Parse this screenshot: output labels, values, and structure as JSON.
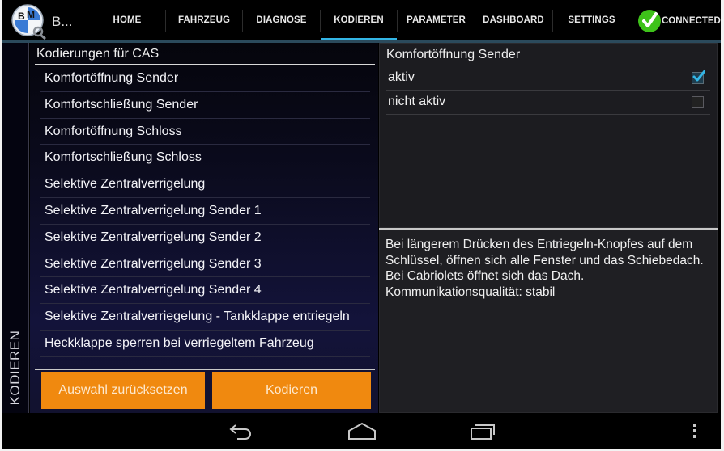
{
  "app": {
    "title": "B...",
    "logo_icon": "bm-logo-magnifier-icon"
  },
  "tabs": [
    {
      "label": "HOME",
      "active": false
    },
    {
      "label": "FAHRZEUG",
      "active": false
    },
    {
      "label": "DIAGNOSE",
      "active": false
    },
    {
      "label": "KODIEREN",
      "active": true
    },
    {
      "label": "PARAMETER",
      "active": false
    },
    {
      "label": "DASHBOARD",
      "active": false
    },
    {
      "label": "SETTINGS",
      "active": false
    }
  ],
  "connection": {
    "label": "CONNECTED",
    "icon": "green-check-icon",
    "color": "#3ec21a"
  },
  "sidebar": {
    "label": "KODIEREN"
  },
  "left_panel": {
    "header": "Kodierungen für CAS",
    "items": [
      "Komfortöffnung Sender",
      "Komfortschließung Sender",
      "Komfortöffnung Schloss",
      "Komfortschließung Schloss",
      "Selektive Zentralverrigelung",
      "Selektive Zentralverrigelung Sender 1",
      "Selektive Zentralverrigelung Sender 2",
      "Selektive Zentralverrigelung Sender 3",
      "Selektive Zentralverrigelung Sender 4",
      "Selektive Zentralverriegelung - Tankklappe entriegeln",
      "Heckklappe sperren bei verriegeltem Fahrzeug"
    ],
    "buttons": {
      "reset": "Auswahl zurücksetzen",
      "code": "Kodieren"
    }
  },
  "right_panel": {
    "header": "Komfortöffnung Sender",
    "options": [
      {
        "label": "aktiv",
        "checked": true
      },
      {
        "label": "nicht aktiv",
        "checked": false
      }
    ],
    "description": "Bei längerem Drücken des Entriegeln-Knopfes auf dem Schlüssel, öffnen sich alle Fenster und das Schiebedach. Bei Cabriolets öffnet sich das Dach. Kommunikationsqualität: stabil"
  },
  "navbar": {
    "back_icon": "back-icon",
    "home_icon": "home-icon",
    "recents_icon": "recent-apps-icon",
    "menu_icon": "overflow-menu-icon"
  },
  "colors": {
    "accent": "#33b5e5",
    "button": "#f0890f",
    "connected": "#3ec21a"
  }
}
